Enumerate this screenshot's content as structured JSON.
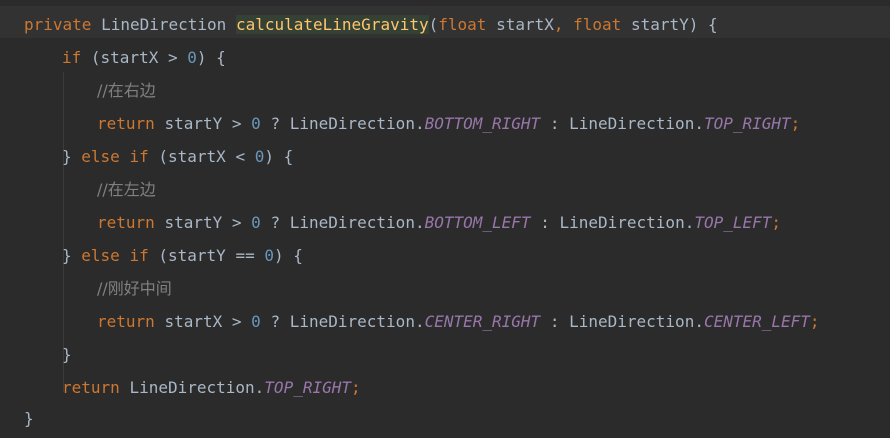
{
  "code": {
    "sig": {
      "kw_private": "private",
      "ret_type": "LineDirection",
      "method_name": "calculateLineGravity",
      "lparen": "(",
      "kw_float1": "float",
      "param1": "startX",
      "comma": ",",
      "kw_float2": "float",
      "param2": "startY",
      "rparen": ")",
      "brace": "{"
    },
    "if1": {
      "kw_if": "if",
      "open": "(startX",
      "op": ">",
      "num": "0",
      "close": ") {"
    },
    "comment_right": "//在右边",
    "ret1": {
      "kw_return": "return",
      "var": "startY",
      "op": ">",
      "num": "0",
      "q": "?",
      "cls1": "LineDirection.",
      "c1": "BOTTOM_RIGHT",
      "colon": ":",
      "cls2": "LineDirection.",
      "c2": "TOP_RIGHT",
      "semi": ";"
    },
    "elseif1": {
      "close_brace": "}",
      "kw_else": "else",
      "kw_if": "if",
      "open": "(startX",
      "op": "<",
      "num": "0",
      "close": ") {"
    },
    "comment_left": "//在左边",
    "ret2": {
      "kw_return": "return",
      "var": "startY",
      "op": ">",
      "num": "0",
      "q": "?",
      "cls1": "LineDirection.",
      "c1": "BOTTOM_LEFT",
      "colon": ":",
      "cls2": "LineDirection.",
      "c2": "TOP_LEFT",
      "semi": ";"
    },
    "elseif2": {
      "close_brace": "}",
      "kw_else": "else",
      "kw_if": "if",
      "open": "(startY",
      "op": "==",
      "num": "0",
      "close": ") {"
    },
    "comment_center": "//刚好中间",
    "ret3": {
      "kw_return": "return",
      "var": "startX",
      "op": ">",
      "num": "0",
      "q": "?",
      "cls1": "LineDirection.",
      "c1": "CENTER_RIGHT",
      "colon": ":",
      "cls2": "LineDirection.",
      "c2": "CENTER_LEFT",
      "semi": ";"
    },
    "close_if": "}",
    "final_ret": {
      "kw_return": "return",
      "cls": "LineDirection.",
      "c": "TOP_RIGHT",
      "semi": ";"
    },
    "close_method": "}"
  },
  "colors": {
    "background": "#2b2b2b",
    "keyword": "#cc7832",
    "number": "#6897bb",
    "method": "#ffc66d",
    "comment": "#808080",
    "constant": "#9876aa",
    "text": "#a9b7c6"
  }
}
